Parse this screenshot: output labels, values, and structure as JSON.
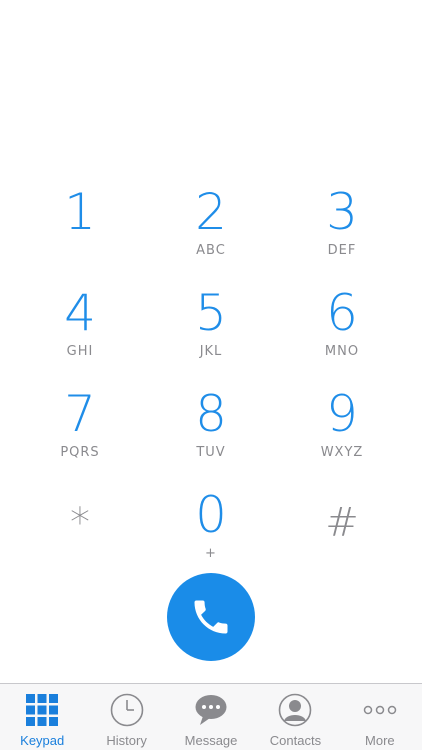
{
  "keypad": {
    "keys": [
      {
        "digit": "1",
        "letters": ""
      },
      {
        "digit": "2",
        "letters": "ABC"
      },
      {
        "digit": "3",
        "letters": "DEF"
      },
      {
        "digit": "4",
        "letters": "GHI"
      },
      {
        "digit": "5",
        "letters": "JKL"
      },
      {
        "digit": "6",
        "letters": "MNO"
      },
      {
        "digit": "7",
        "letters": "PQRS"
      },
      {
        "digit": "8",
        "letters": "TUV"
      },
      {
        "digit": "9",
        "letters": "WXYZ"
      },
      {
        "digit": "*",
        "letters": ""
      },
      {
        "digit": "0",
        "letters": "+"
      },
      {
        "digit": "#",
        "letters": ""
      }
    ]
  },
  "call": {
    "icon": "phone-icon",
    "color": "#1a8ce8"
  },
  "tabbar": {
    "tabs": [
      {
        "label": "Keypad",
        "icon": "keypad-grid-icon",
        "active": true
      },
      {
        "label": "History",
        "icon": "clock-icon",
        "active": false
      },
      {
        "label": "Message",
        "icon": "chat-bubble-icon",
        "active": false
      },
      {
        "label": "Contacts",
        "icon": "contact-person-icon",
        "active": false
      },
      {
        "label": "More",
        "icon": "more-dots-icon",
        "active": false
      }
    ]
  },
  "colors": {
    "accent": "#1f8de8",
    "secondary_text": "#8a8a8e",
    "tab_active": "#1a7fdc"
  }
}
